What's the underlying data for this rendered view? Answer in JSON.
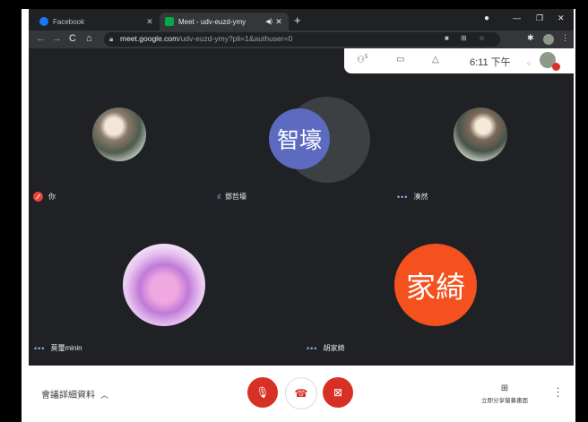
{
  "tabs": [
    {
      "title": "Facebook",
      "icon": "facebook-icon",
      "color": "#1877f2"
    },
    {
      "title": "Meet - udv-euzd-ymy",
      "icon": "meet-icon",
      "color": "#00ac47",
      "audio_icon": "speaker-icon"
    }
  ],
  "address": {
    "domain": "meet.google.com",
    "path": "/udv-euzd-ymy?pli=1&authuser=0"
  },
  "meet_top": {
    "people_count": "5",
    "time": "6:11 下午"
  },
  "participants": [
    {
      "name": "你",
      "status": "muted",
      "avatar": "anime-photo"
    },
    {
      "name": "鄧哲壕",
      "status": "speaking",
      "initials": "智壕",
      "color": "#5c6bc0"
    },
    {
      "name": "湊然",
      "status": "connected",
      "avatar": "anime-photo"
    },
    {
      "name": "莫璽minin",
      "status": "connected",
      "avatar": "purple-anime-photo"
    },
    {
      "name": "胡家綺",
      "status": "connected",
      "initials": "家綺",
      "color": "#f4511e"
    }
  ],
  "bottom": {
    "details": "會議詳細資料",
    "present": "立即分享螢幕畫面"
  },
  "colors": {
    "accent_red": "#d93025",
    "meet_bg": "#202124",
    "highlight_blue": "#8ab4f8"
  }
}
